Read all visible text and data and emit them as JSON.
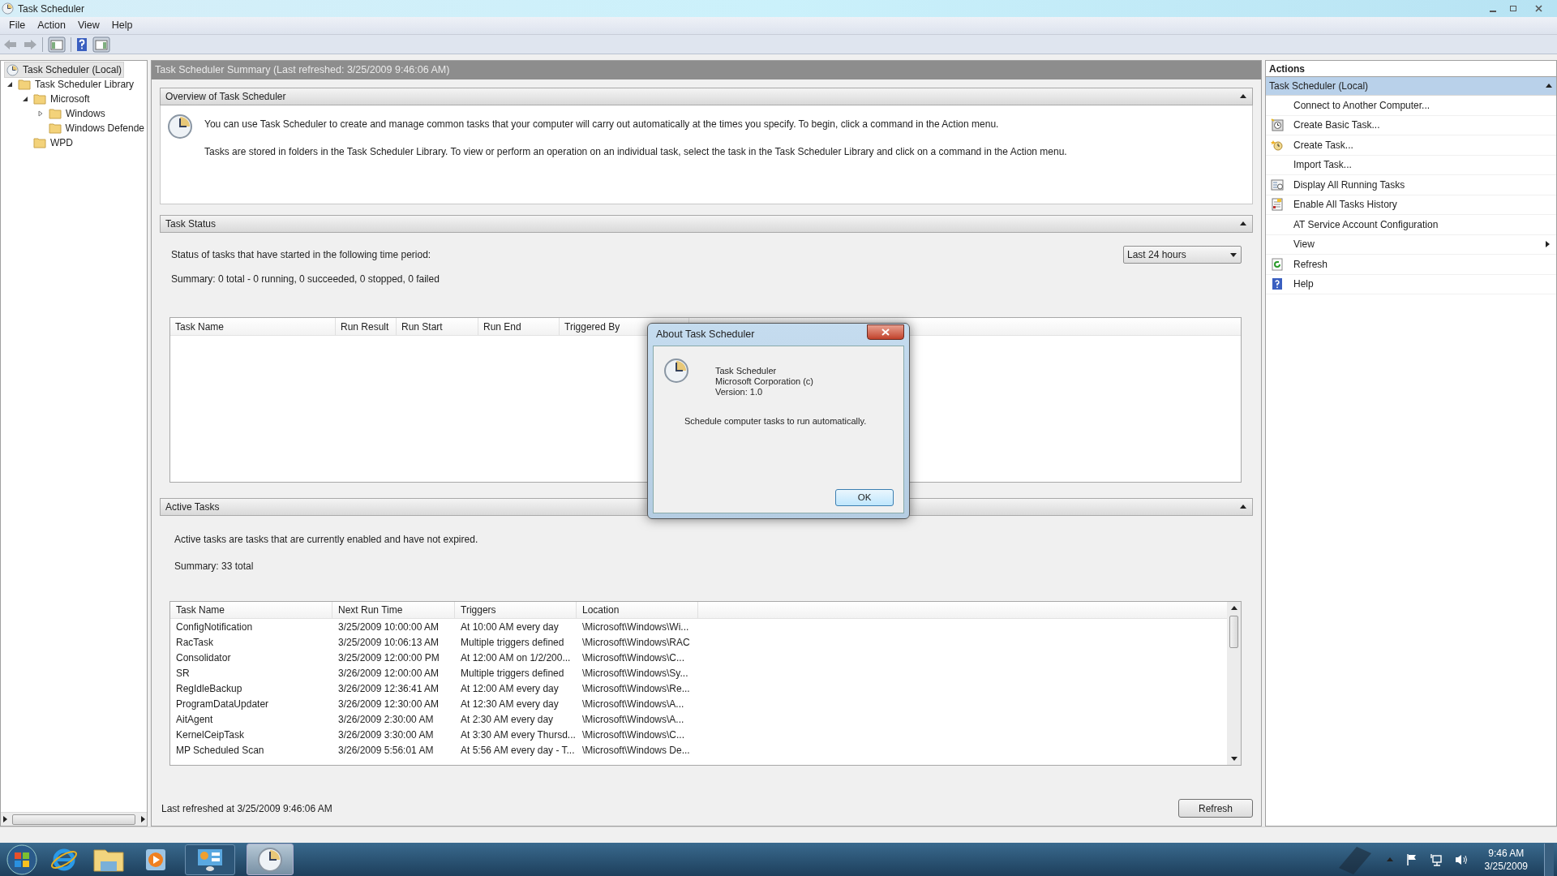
{
  "window": {
    "title": "Task Scheduler"
  },
  "menu": [
    "File",
    "Action",
    "View",
    "Help"
  ],
  "tree": [
    {
      "label": "Task Scheduler (Local)",
      "selected": true,
      "children": [
        {
          "label": "Task Scheduler Library",
          "selected": false,
          "expanded": true,
          "children": [
            {
              "label": "Microsoft",
              "selected": false,
              "expanded": true,
              "children": [
                {
                  "label": "Windows",
                  "selected": false,
                  "expanded": false
                },
                {
                  "label": "Windows Defende",
                  "selected": false
                }
              ]
            },
            {
              "label": "WPD",
              "selected": false
            }
          ]
        }
      ]
    }
  ],
  "summary": {
    "header": "Task Scheduler Summary (Last refreshed: 3/25/2009 9:46:06 AM)",
    "overview": {
      "title": "Overview of Task Scheduler",
      "expanded": true,
      "paragraphs": [
        "You can use Task Scheduler to create and manage common tasks that your computer will carry out automatically at the times you specify. To begin, click a command in the Action menu.",
        "Tasks are stored in folders in the Task Scheduler Library. To view or perform an operation on an individual task, select the task in the Task Scheduler Library and click on a command in the Action menu."
      ]
    },
    "task_status": {
      "title": "Task Status",
      "expanded": true,
      "period_label": "Status of tasks that have started in the following time period:",
      "period": "Last 24 hours",
      "summary": "Summary: 0 total - 0 running, 0 succeeded, 0 stopped, 0 failed",
      "columns": [
        "Task Name",
        "Run Result",
        "Run Start",
        "Run End",
        "Triggered By"
      ]
    },
    "active_tasks": {
      "title": "Active Tasks",
      "expanded": true,
      "description": "Active tasks are tasks that are currently enabled and have not expired.",
      "summary": "Summary: 33 total",
      "columns": [
        "Task Name",
        "Next Run Time",
        "Triggers",
        "Location"
      ],
      "rows": [
        [
          "ConfigNotification",
          "3/25/2009 10:00:00 AM",
          "At 10:00 AM every day",
          "\\Microsoft\\Windows\\Wi..."
        ],
        [
          "RacTask",
          "3/25/2009 10:06:13 AM",
          "Multiple triggers defined",
          "\\Microsoft\\Windows\\RAC"
        ],
        [
          "Consolidator",
          "3/25/2009 12:00:00 PM",
          "At 12:00 AM on 1/2/200...",
          "\\Microsoft\\Windows\\C..."
        ],
        [
          "SR",
          "3/26/2009 12:00:00 AM",
          "Multiple triggers defined",
          "\\Microsoft\\Windows\\Sy..."
        ],
        [
          "RegIdleBackup",
          "3/26/2009 12:36:41 AM",
          "At 12:00 AM every day",
          "\\Microsoft\\Windows\\Re..."
        ],
        [
          "ProgramDataUpdater",
          "3/26/2009 12:30:00 AM",
          "At 12:30 AM every day",
          "\\Microsoft\\Windows\\A..."
        ],
        [
          "AitAgent",
          "3/26/2009 2:30:00 AM",
          "At 2:30 AM every day",
          "\\Microsoft\\Windows\\A..."
        ],
        [
          "KernelCeipTask",
          "3/26/2009 3:30:00 AM",
          "At 3:30 AM every Thursd...",
          "\\Microsoft\\Windows\\C..."
        ],
        [
          "MP Scheduled Scan",
          "3/26/2009 5:56:01 AM",
          "At 5:56 AM every day - T...",
          "\\Microsoft\\Windows De..."
        ]
      ]
    },
    "footer": {
      "last_refreshed": "Last refreshed at 3/25/2009 9:46:06 AM",
      "refresh_button": "Refresh"
    }
  },
  "actions": {
    "title": "Actions",
    "group": {
      "title": "Task Scheduler (Local)",
      "expanded": true
    },
    "items": [
      {
        "label": "Connect to Another Computer...",
        "kind": "plain",
        "submenu": false
      },
      {
        "label": "Create Basic Task...",
        "kind": "basic-task",
        "submenu": false
      },
      {
        "label": "Create Task...",
        "kind": "new-task",
        "submenu": false
      },
      {
        "label": "Import Task...",
        "kind": "plain",
        "submenu": false
      },
      {
        "label": "Display All Running Tasks",
        "kind": "running",
        "submenu": false
      },
      {
        "label": "Enable All Tasks History",
        "kind": "history",
        "submenu": false
      },
      {
        "label": "AT Service Account Configuration",
        "kind": "plain",
        "submenu": false
      },
      {
        "label": "View",
        "kind": "plain",
        "submenu": true
      },
      {
        "label": "Refresh",
        "kind": "refresh",
        "submenu": false
      },
      {
        "label": "Help",
        "kind": "help",
        "submenu": false
      }
    ]
  },
  "dialog": {
    "title": "About Task Scheduler",
    "lines": [
      "Task Scheduler",
      "Microsoft Corporation (c)",
      "Version: 1.0"
    ],
    "description": "Schedule computer tasks to run automatically.",
    "ok_button": "OK"
  },
  "taskbar": {
    "time": "9:46 AM",
    "date": "3/25/2009"
  }
}
